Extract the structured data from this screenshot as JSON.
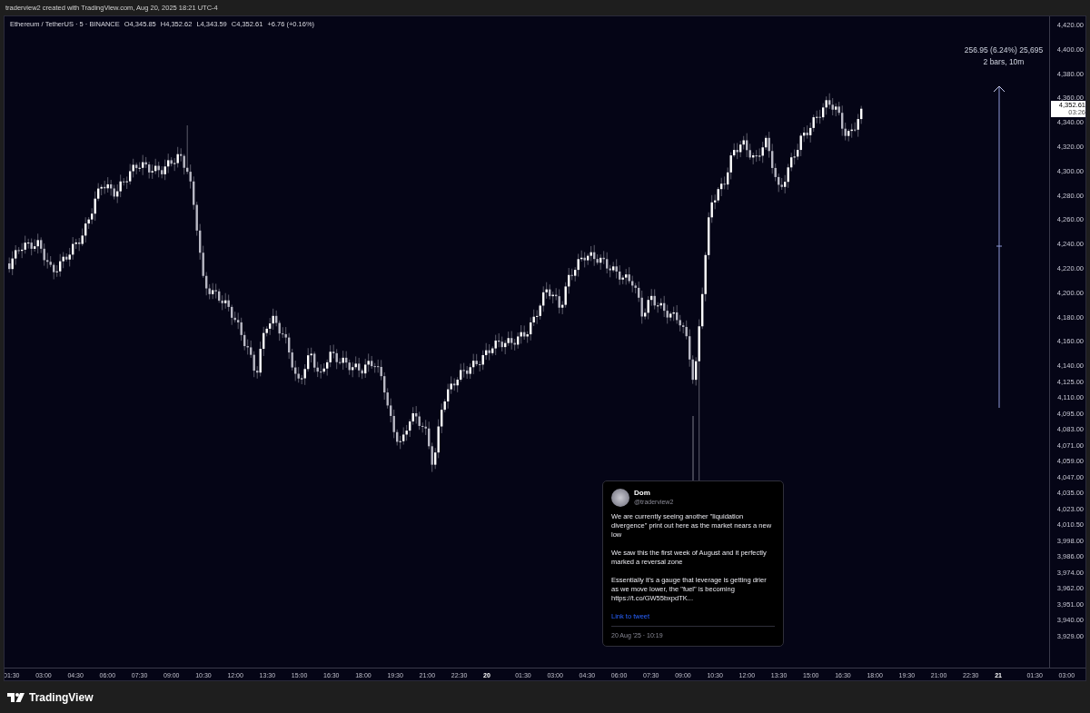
{
  "header": {
    "attribution": "traderview2 created with TradingView.com, Aug 20, 2025 18:21 UTC-4"
  },
  "legend": {
    "symbol": "Ethereum / TetherUS · 5 · BINANCE",
    "open": "O4,345.85",
    "high": "H4,352.62",
    "low": "L4,343.59",
    "close": "C4,352.61",
    "change": "+6.76 (+0.16%)"
  },
  "measure": {
    "line1": "256.95 (6.24%) 25,695",
    "line2": "2 bars, 10m"
  },
  "price_axis": {
    "labels": [
      "4,420.00",
      "4,400.00",
      "4,380.00",
      "4,360.00",
      "4,340.00",
      "4,320.00",
      "4,300.00",
      "4,280.00",
      "4,260.00",
      "4,240.00",
      "4,220.00",
      "4,200.00",
      "4,180.00",
      "4,160.00",
      "4,140.00",
      "4,125.00",
      "4,110.00",
      "4,095.00",
      "4,083.00",
      "4,071.00",
      "4,059.00",
      "4,047.00",
      "4,035.00",
      "4,023.00",
      "4,010.50",
      "3,998.00",
      "3,986.00",
      "3,974.00",
      "3,962.00",
      "3,951.00",
      "3,940.00",
      "3,929.00"
    ],
    "last_price": "4,352.61",
    "countdown": "03:26"
  },
  "time_axis": {
    "labels": [
      {
        "text": "01:30",
        "kind": "time"
      },
      {
        "text": "03:00",
        "kind": "time"
      },
      {
        "text": "04:30",
        "kind": "time"
      },
      {
        "text": "06:00",
        "kind": "time"
      },
      {
        "text": "07:30",
        "kind": "time"
      },
      {
        "text": "09:00",
        "kind": "time"
      },
      {
        "text": "10:30",
        "kind": "time"
      },
      {
        "text": "12:00",
        "kind": "time"
      },
      {
        "text": "13:30",
        "kind": "time"
      },
      {
        "text": "15:00",
        "kind": "time"
      },
      {
        "text": "16:30",
        "kind": "time"
      },
      {
        "text": "18:00",
        "kind": "time"
      },
      {
        "text": "19:30",
        "kind": "time"
      },
      {
        "text": "21:00",
        "kind": "time"
      },
      {
        "text": "22:30",
        "kind": "time"
      },
      {
        "text": "20",
        "kind": "day"
      },
      {
        "text": "01:30",
        "kind": "time"
      },
      {
        "text": "03:00",
        "kind": "time"
      },
      {
        "text": "04:30",
        "kind": "time"
      },
      {
        "text": "06:00",
        "kind": "time"
      },
      {
        "text": "07:30",
        "kind": "time"
      },
      {
        "text": "09:00",
        "kind": "time"
      },
      {
        "text": "10:30",
        "kind": "time"
      },
      {
        "text": "12:00",
        "kind": "time"
      },
      {
        "text": "13:30",
        "kind": "time"
      },
      {
        "text": "15:00",
        "kind": "time"
      },
      {
        "text": "16:30",
        "kind": "time"
      },
      {
        "text": "18:00",
        "kind": "time"
      },
      {
        "text": "19:30",
        "kind": "time"
      },
      {
        "text": "21:00",
        "kind": "time"
      },
      {
        "text": "22:30",
        "kind": "time"
      },
      {
        "text": "21",
        "kind": "day"
      },
      {
        "text": "01:30",
        "kind": "time"
      },
      {
        "text": "03:00",
        "kind": "time"
      }
    ]
  },
  "tweet": {
    "name": "Dom",
    "handle": "@traderview2",
    "paragraphs": [
      "We are currently seeing another \"liquidation divergence\" print out here as the market nears a new low",
      "We saw this the first week of August and it perfectly marked a reversal zone",
      "Essentially it's a gauge that leverage is getting drier as we move lower, the \"fuel\" is becoming https://t.co/GW55bxpdTK..."
    ],
    "link": "Link to tweet",
    "timestamp": "20 Aug '25 · 10:19"
  },
  "footer": {
    "brand": "TradingView"
  }
}
